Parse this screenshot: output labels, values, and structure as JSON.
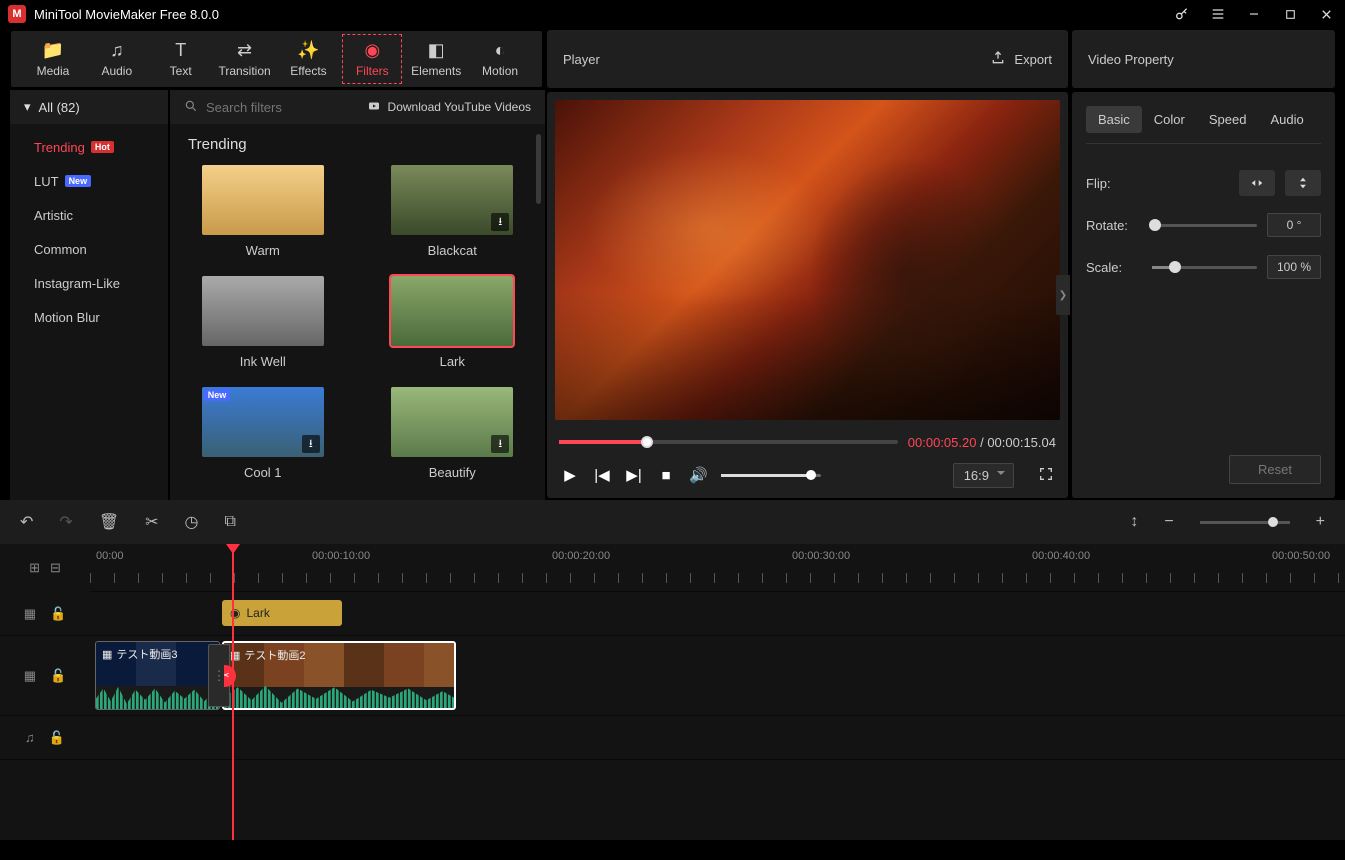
{
  "app": {
    "title": "MiniTool MovieMaker Free 8.0.0"
  },
  "toptabs": {
    "media": "Media",
    "audio": "Audio",
    "text": "Text",
    "transition": "Transition",
    "effects": "Effects",
    "filters": "Filters",
    "elements": "Elements",
    "motion": "Motion"
  },
  "categories": {
    "all_label": "All (82)",
    "items": [
      {
        "id": "trending",
        "label": "Trending",
        "badge": "Hot",
        "active": true
      },
      {
        "id": "lut",
        "label": "LUT",
        "badge": "New"
      },
      {
        "id": "artistic",
        "label": "Artistic"
      },
      {
        "id": "common",
        "label": "Common"
      },
      {
        "id": "instagram",
        "label": "Instagram-Like"
      },
      {
        "id": "motionblur",
        "label": "Motion Blur"
      }
    ]
  },
  "filters": {
    "search_placeholder": "Search filters",
    "download_label": "Download YouTube Videos",
    "section_title": "Trending",
    "items": [
      {
        "id": "warm",
        "label": "Warm"
      },
      {
        "id": "blackcat",
        "label": "Blackcat",
        "dl": true
      },
      {
        "id": "inkwell",
        "label": "Ink Well"
      },
      {
        "id": "lark",
        "label": "Lark",
        "selected": true
      },
      {
        "id": "cool1",
        "label": "Cool 1",
        "dl": true,
        "new": true
      },
      {
        "id": "beautify",
        "label": "Beautify",
        "dl": true
      }
    ]
  },
  "player": {
    "title": "Player",
    "export": "Export",
    "current_time": "00:00:05.20",
    "sep": " / ",
    "total_time": "00:00:15.04",
    "aspect": "16:9"
  },
  "property": {
    "title": "Video Property",
    "tabs": {
      "basic": "Basic",
      "color": "Color",
      "speed": "Speed",
      "audio": "Audio"
    },
    "flip": "Flip:",
    "rotate": "Rotate:",
    "rotate_val": "0 °",
    "scale": "Scale:",
    "scale_val": "100 %",
    "reset": "Reset"
  },
  "timeline": {
    "markers": [
      "00:00",
      "00:00:10:00",
      "00:00:20:00",
      "00:00:30:00",
      "00:00:40:00",
      "00:00:50:00"
    ],
    "filter_clip": "Lark",
    "clip1": "テスト動画3",
    "clip2": "テスト動画2"
  }
}
